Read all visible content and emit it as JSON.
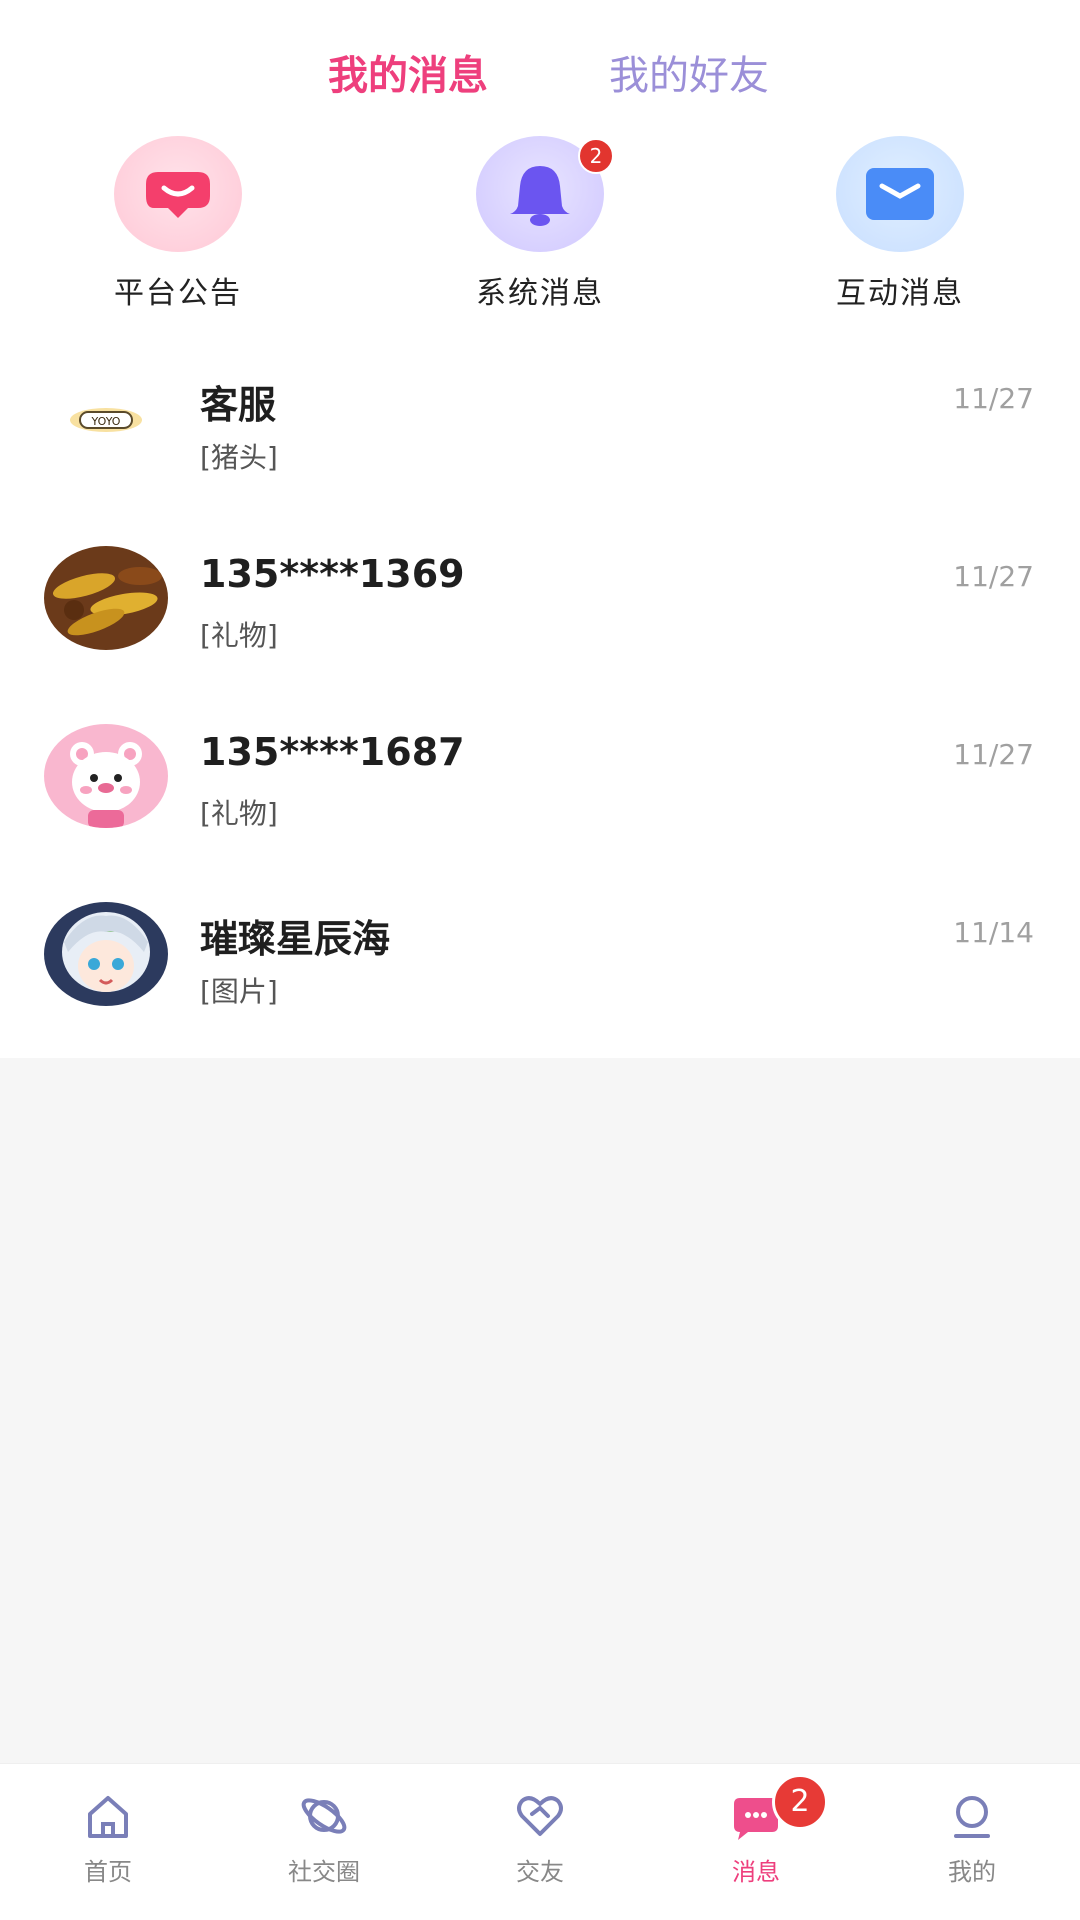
{
  "tabs": [
    {
      "label": "我的消息",
      "active": true
    },
    {
      "label": "我的好友",
      "active": false
    }
  ],
  "categories": [
    {
      "label": "平台公告",
      "icon": "speech-heart-icon",
      "color": "#f43f6c"
    },
    {
      "label": "系统消息",
      "icon": "bell-icon",
      "color": "#6b55f0",
      "badge": "2"
    },
    {
      "label": "互动消息",
      "icon": "envelope-icon",
      "color": "#4a8cf7"
    }
  ],
  "conversations": [
    {
      "name": "客服",
      "preview": "[猪头]",
      "date": "11/27",
      "avatar": "yoyo-logo-avatar"
    },
    {
      "name": "135****1369",
      "preview": "[礼物]",
      "date": "11/27",
      "avatar": "roasted-corn-avatar"
    },
    {
      "name": "135****1687",
      "preview": "[礼物]",
      "date": "11/27",
      "avatar": "pink-bear-avatar"
    },
    {
      "name": "璀璨星辰海",
      "preview": "[图片]",
      "date": "11/14",
      "avatar": "anime-girl-avatar"
    }
  ],
  "nav": [
    {
      "label": "首页",
      "icon": "home-icon"
    },
    {
      "label": "社交圈",
      "icon": "planet-icon"
    },
    {
      "label": "交友",
      "icon": "heart-handshake-icon"
    },
    {
      "label": "消息",
      "icon": "chat-bubble-icon",
      "active": true,
      "badge": "2"
    },
    {
      "label": "我的",
      "icon": "profile-icon"
    }
  ],
  "colors": {
    "accent": "#ee3f7d",
    "inactive_tab": "#9b8fd8",
    "badge": "#e2352f"
  }
}
